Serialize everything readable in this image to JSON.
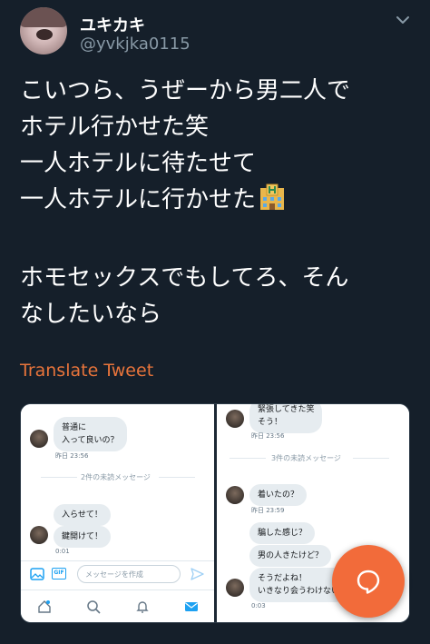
{
  "header": {
    "display_name": "ユキカキ",
    "handle": "@yvkjka0115"
  },
  "tweet": {
    "lines": [
      "こいつら、うぜーから男二人で",
      "ホテル行かせた笑",
      "一人ホテルに待たせて",
      "一人ホテルに行かせた",
      "",
      "ホモセックスでもしてろ、そん",
      "なしたいなら"
    ],
    "translate_label": "Translate Tweet"
  },
  "left_screenshot": {
    "msg1": "普通に",
    "msg1b": "入って良いの？",
    "time1": "昨日 23:56",
    "unread_divider": "2件の未読メッセージ",
    "msg2": "入らせて！",
    "msg3": "鍵開けて！",
    "time2": "0:01",
    "compose_placeholder": "メッセージを作成",
    "gif_label": "GIF"
  },
  "right_screenshot": {
    "msg1": "緊張してきた笑",
    "msg1b": "そう！",
    "time1": "昨日 23:56",
    "unread_divider": "3件の未読メッセージ",
    "msg2": "着いたの？",
    "time2": "昨日 23:59",
    "msg3": "騙した感じ？",
    "msg4": "男の人きたけど？",
    "msg5": "そうだよね！",
    "msg5b": "いきなり会うわけない",
    "time3": "0:03"
  },
  "colors": {
    "background": "#151f2a",
    "accent": "#e8743b",
    "fab": "#f26b3a",
    "link_blue": "#1da1f2"
  },
  "icons": {
    "chevron": "chevron-down-icon",
    "hotel": "hotel-emoji-icon",
    "fab": "reply-bubble-icon"
  }
}
